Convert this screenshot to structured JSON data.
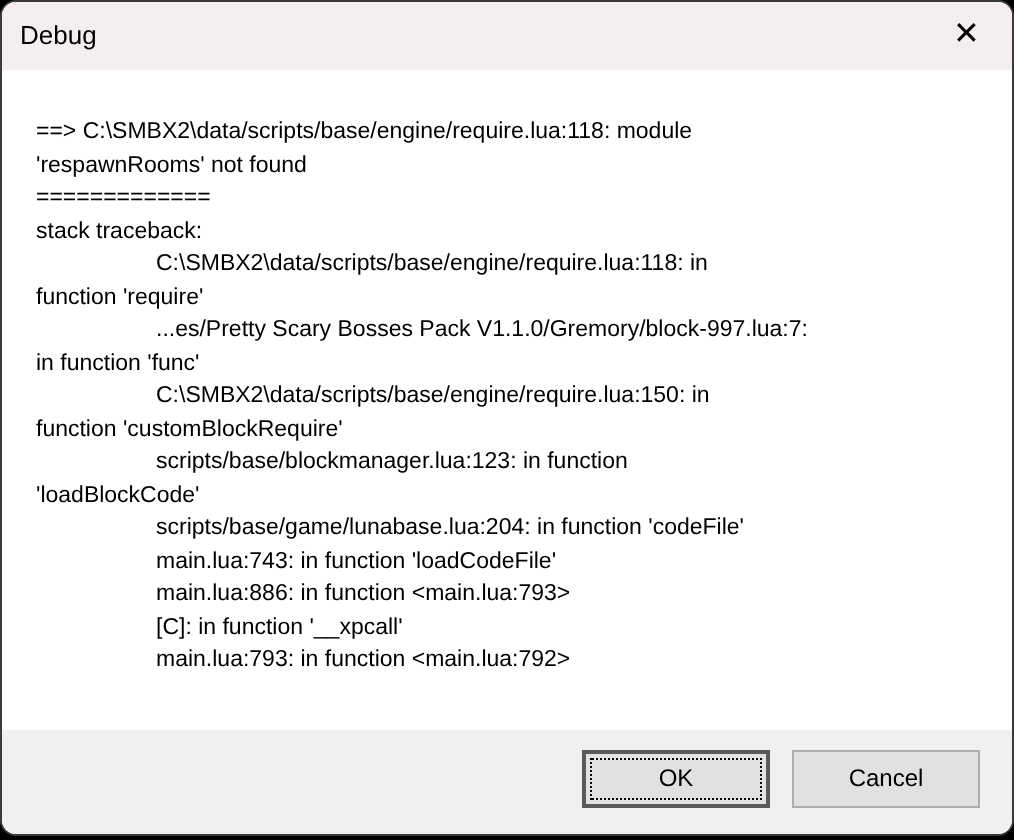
{
  "window": {
    "title": "Debug",
    "close_glyph": "✕"
  },
  "message_lines": [
    {
      "kind": "plain",
      "text": "==> C:\\SMBX2\\data/scripts/base/engine/require.lua:118: module"
    },
    {
      "kind": "plain",
      "text": "'respawnRooms' not found"
    },
    {
      "kind": "plain",
      "text": "============="
    },
    {
      "kind": "plain",
      "text": "stack traceback:"
    },
    {
      "kind": "indented",
      "text": "C:\\SMBX2\\data/scripts/base/engine/require.lua:118: in"
    },
    {
      "kind": "plain",
      "text": "function 'require'"
    },
    {
      "kind": "indented",
      "text": "...es/Pretty Scary Bosses Pack V1.1.0/Gremory/block-997.lua:7:"
    },
    {
      "kind": "plain",
      "text": "in function 'func'"
    },
    {
      "kind": "indented",
      "text": "C:\\SMBX2\\data/scripts/base/engine/require.lua:150: in"
    },
    {
      "kind": "plain",
      "text": "function 'customBlockRequire'"
    },
    {
      "kind": "indented",
      "text": "scripts/base/blockmanager.lua:123: in function"
    },
    {
      "kind": "plain",
      "text": "'loadBlockCode'"
    },
    {
      "kind": "indented",
      "text": "scripts/base/game/lunabase.lua:204: in function 'codeFile'"
    },
    {
      "kind": "indented",
      "text": "main.lua:743: in function 'loadCodeFile'"
    },
    {
      "kind": "indented",
      "text": "main.lua:886: in function <main.lua:793>"
    },
    {
      "kind": "indented",
      "text": "[C]: in function '__xpcall'"
    },
    {
      "kind": "indented",
      "text": "main.lua:793: in function <main.lua:792>"
    }
  ],
  "buttons": [
    {
      "label": "OK",
      "selected": true
    },
    {
      "label": "Cancel",
      "selected": false
    }
  ]
}
